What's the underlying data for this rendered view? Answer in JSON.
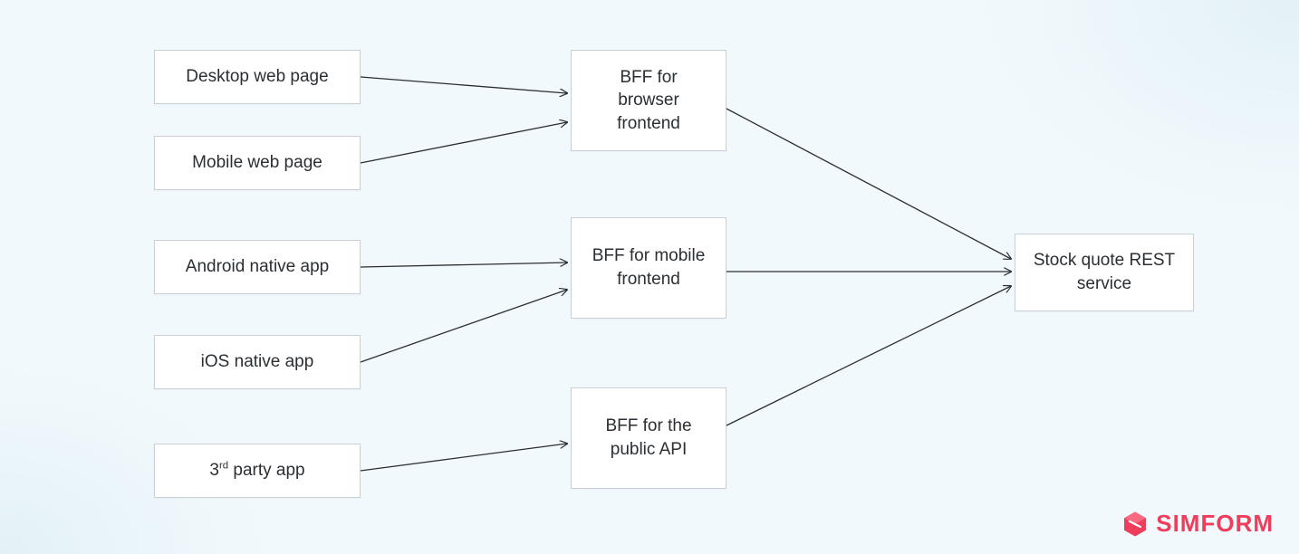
{
  "clients": [
    {
      "id": "desktop",
      "label": "Desktop web page"
    },
    {
      "id": "mobweb",
      "label": "Mobile web page"
    },
    {
      "id": "android",
      "label": "Android native app"
    },
    {
      "id": "ios",
      "label": "iOS native app"
    },
    {
      "id": "third",
      "label_html": "3<sup>rd</sup> party app"
    }
  ],
  "bffs": [
    {
      "id": "bff-browser",
      "label": "BFF for browser frontend"
    },
    {
      "id": "bff-mobile",
      "label": "BFF for mobile frontend"
    },
    {
      "id": "bff-public",
      "label": "BFF for the public API"
    }
  ],
  "service": {
    "id": "stock",
    "label": "Stock quote REST service"
  },
  "edges": [
    {
      "from": "desktop",
      "to": "bff-browser"
    },
    {
      "from": "mobweb",
      "to": "bff-browser"
    },
    {
      "from": "android",
      "to": "bff-mobile"
    },
    {
      "from": "ios",
      "to": "bff-mobile"
    },
    {
      "from": "third",
      "to": "bff-public"
    },
    {
      "from": "bff-browser",
      "to": "stock"
    },
    {
      "from": "bff-mobile",
      "to": "stock"
    },
    {
      "from": "bff-public",
      "to": "stock"
    }
  ],
  "brand": {
    "name": "SIMFORM"
  },
  "colors": {
    "box_border": "#c9cfd6",
    "text": "#2b2f33",
    "line": "#2b2f33",
    "brand": "#ef3e5b"
  }
}
